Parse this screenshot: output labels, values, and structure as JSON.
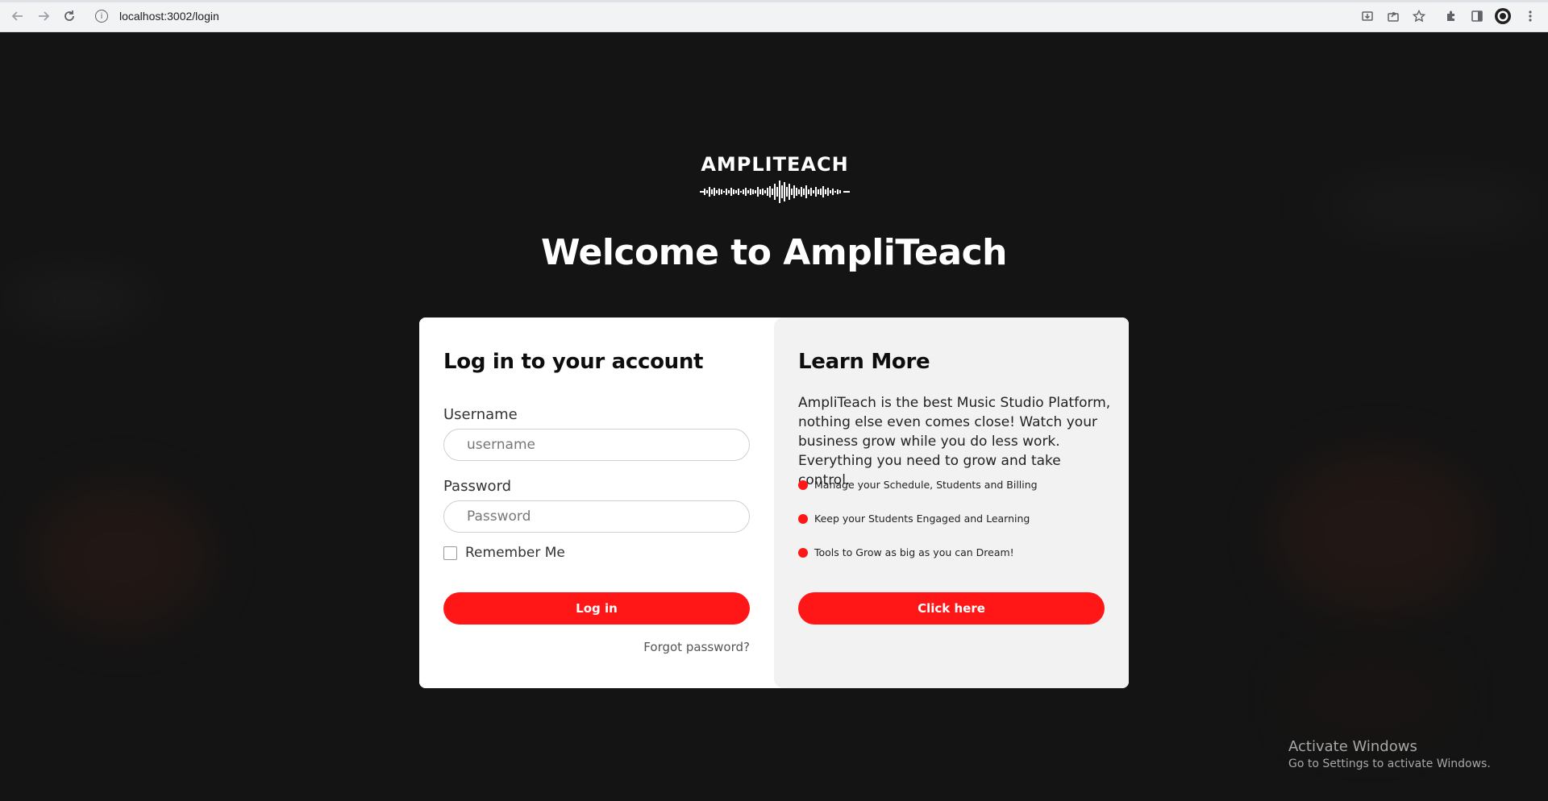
{
  "browser": {
    "url": "localhost:3002/login",
    "icons": [
      "back-icon",
      "forward-icon",
      "reload-icon",
      "info-icon",
      "install-icon",
      "share-icon",
      "bookmark-star-icon",
      "extensions-icon",
      "sidepanel-icon",
      "profile-icon",
      "menu-icon"
    ]
  },
  "brand": {
    "logo_text": "AMPLITEACH",
    "accent": "#ff1717"
  },
  "welcome": "Welcome to AmpliTeach",
  "login": {
    "title": "Log in to your account",
    "username_label": "Username",
    "username_placeholder": "username",
    "password_label": "Password",
    "password_placeholder": "Password",
    "remember_label": "Remember Me",
    "login_button": "Log in",
    "forgot_link": "Forgot password?"
  },
  "learn": {
    "title": "Learn More",
    "description": "AmpliTeach is the best Music Studio Platform, nothing else even comes close! Watch your business grow while you do less work. Everything you need to grow and take control.",
    "bullets": [
      "Manage your Schedule, Students and Billing",
      "Keep your Students Engaged and Learning",
      "Tools to Grow as big as you can Dream!"
    ],
    "button": "Click here"
  },
  "os_watermark": {
    "title": "Activate Windows",
    "subtitle": "Go to Settings to activate Windows."
  }
}
